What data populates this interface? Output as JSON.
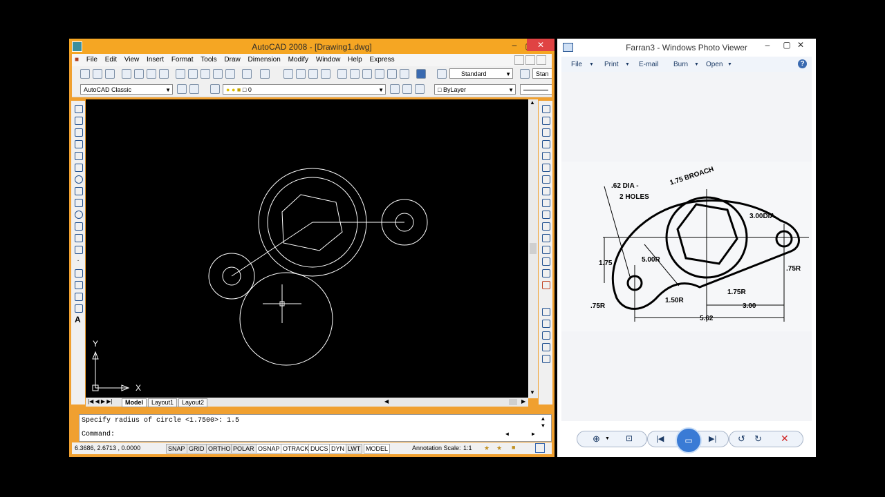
{
  "acad": {
    "title": "AutoCAD 2008 - [Drawing1.dwg]",
    "menu": [
      "File",
      "Edit",
      "View",
      "Insert",
      "Format",
      "Tools",
      "Draw",
      "Dimension",
      "Modify",
      "Window",
      "Help",
      "Express"
    ],
    "workspace": "AutoCAD Classic",
    "text_style": "Standard",
    "dim_style": "Stan",
    "layer": "0",
    "color": "ByLayer",
    "tabs": [
      "Model",
      "Layout1",
      "Layout2"
    ],
    "cmd_line1": "Specify radius of circle <1.7500>: 1.5",
    "cmd_line2": "Command:",
    "coords": "6.3686, 2.6713 , 0.0000",
    "status_buttons": [
      "SNAP",
      "GRID",
      "ORTHO",
      "POLAR",
      "OSNAP",
      "OTRACK",
      "DUCS",
      "DYN",
      "LWT",
      "MODEL"
    ],
    "annotation_label": "Annotation Scale:",
    "annotation_scale": "1:1",
    "ucs_x": "X",
    "ucs_y": "Y"
  },
  "viewer": {
    "title": "Farran3 - Windows Photo Viewer",
    "menu": [
      "File",
      "Print",
      "E-mail",
      "Burn",
      "Open"
    ],
    "help": "?",
    "drawing_labels": {
      "dia": ".62 DIA -",
      "holes": "2 HOLES",
      "broach": "1.75 BROACH",
      "dia300": "3.00DIA",
      "r500": "5.00R",
      "h175": "1.75",
      "r75a": ".75R",
      "r75b": ".75R",
      "r150": "1.50R",
      "r175": "1.75R",
      "d300": "3.00",
      "d562": "5.62"
    }
  },
  "colors": {
    "acad_title": "#f5a623",
    "canvas": "#000000",
    "close": "#e04343",
    "viewer_accent": "#1c3b66"
  }
}
